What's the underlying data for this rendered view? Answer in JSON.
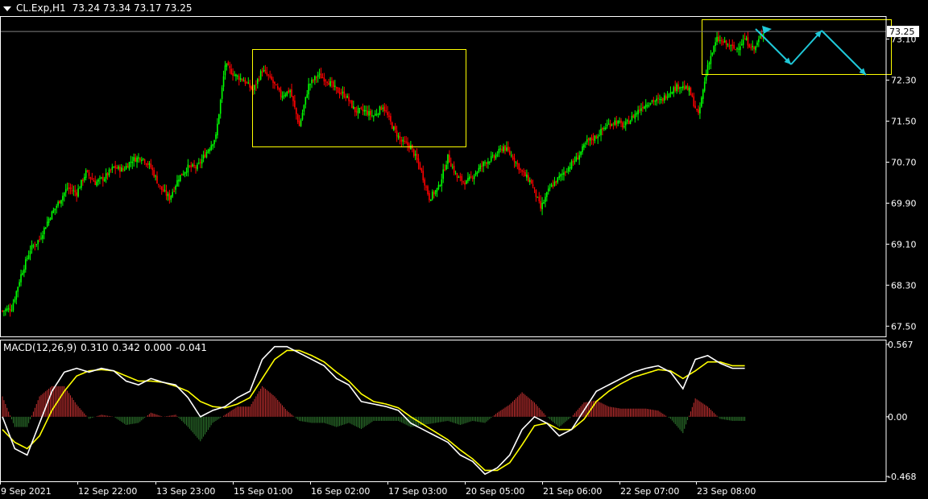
{
  "header": {
    "symbol_timeframe": "CL.Exp,H1",
    "ohlc": "73.24 73.34 73.17 73.25"
  },
  "macd": {
    "label": "MACD(12,26,9)",
    "values": [
      "0.310",
      "0.342",
      "0.000",
      "-0.041"
    ]
  },
  "colors": {
    "background": "#000000",
    "bull": "#00ff00",
    "bear": "#ff0000",
    "grid_border": "#ffffff",
    "box": "#ffff00",
    "arrow": "#1fc8d8",
    "price_line": "#808080",
    "hist_pos": "#c83232",
    "hist_neg": "#2f7a2f",
    "macd_line": "#ffffff",
    "signal_line": "#ffff00"
  },
  "chart_data": [
    {
      "type": "candlestick",
      "ylim": [
        67.3,
        73.55
      ],
      "y_ticks": [
        "73.10",
        "72.30",
        "71.50",
        "70.70",
        "69.90",
        "69.10",
        "68.30",
        "67.50"
      ],
      "current_price": "73.25",
      "x_ticks": [
        "9 Sep 2021",
        "12 Sep 22:00",
        "13 Sep 23:00",
        "15 Sep 01:00",
        "16 Sep 02:00",
        "17 Sep 03:00",
        "20 Sep 05:00",
        "21 Sep 06:00",
        "22 Sep 07:00",
        "23 Sep 08:00"
      ],
      "close_path": [
        [
          0,
          67.8
        ],
        [
          6,
          67.85
        ],
        [
          12,
          68.5
        ],
        [
          18,
          69.0
        ],
        [
          24,
          69.2
        ],
        [
          30,
          69.6
        ],
        [
          36,
          69.9
        ],
        [
          42,
          70.2
        ],
        [
          48,
          70.1
        ],
        [
          54,
          70.5
        ],
        [
          60,
          70.3
        ],
        [
          66,
          70.4
        ],
        [
          72,
          70.6
        ],
        [
          78,
          70.55
        ],
        [
          84,
          70.75
        ],
        [
          90,
          70.8
        ],
        [
          96,
          70.6
        ],
        [
          102,
          70.2
        ],
        [
          108,
          70.0
        ],
        [
          114,
          70.4
        ],
        [
          120,
          70.6
        ],
        [
          126,
          70.6
        ],
        [
          132,
          70.9
        ],
        [
          138,
          71.2
        ],
        [
          144,
          72.6
        ],
        [
          150,
          72.4
        ],
        [
          156,
          72.3
        ],
        [
          162,
          72.1
        ],
        [
          168,
          72.5
        ],
        [
          174,
          72.3
        ],
        [
          180,
          72.0
        ],
        [
          186,
          72.1
        ],
        [
          192,
          71.4
        ],
        [
          198,
          72.2
        ],
        [
          204,
          72.4
        ],
        [
          210,
          72.3
        ],
        [
          216,
          72.1
        ],
        [
          222,
          72.0
        ],
        [
          228,
          71.7
        ],
        [
          234,
          71.7
        ],
        [
          240,
          71.6
        ],
        [
          246,
          71.8
        ],
        [
          252,
          71.4
        ],
        [
          258,
          71.1
        ],
        [
          264,
          71.0
        ],
        [
          270,
          70.6
        ],
        [
          276,
          70.0
        ],
        [
          282,
          70.2
        ],
        [
          288,
          70.8
        ],
        [
          294,
          70.4
        ],
        [
          300,
          70.3
        ],
        [
          306,
          70.5
        ],
        [
          312,
          70.7
        ],
        [
          318,
          70.8
        ],
        [
          324,
          71.0
        ],
        [
          330,
          70.8
        ],
        [
          336,
          70.5
        ],
        [
          342,
          70.3
        ],
        [
          348,
          69.8
        ],
        [
          354,
          70.2
        ],
        [
          360,
          70.4
        ],
        [
          366,
          70.6
        ],
        [
          372,
          70.8
        ],
        [
          378,
          71.1
        ],
        [
          384,
          71.2
        ],
        [
          390,
          71.4
        ],
        [
          396,
          71.5
        ],
        [
          402,
          71.4
        ],
        [
          408,
          71.6
        ],
        [
          414,
          71.8
        ],
        [
          420,
          71.9
        ],
        [
          426,
          71.9
        ],
        [
          432,
          72.1
        ],
        [
          438,
          72.2
        ],
        [
          444,
          72.1
        ],
        [
          450,
          71.6
        ],
        [
          456,
          72.6
        ],
        [
          462,
          73.1
        ],
        [
          468,
          73.0
        ],
        [
          474,
          72.9
        ],
        [
          480,
          73.1
        ],
        [
          486,
          72.9
        ],
        [
          492,
          73.25
        ]
      ]
    },
    {
      "type": "macd",
      "ylim": [
        -0.468,
        0.567
      ],
      "y_ticks": [
        "0.567",
        "0.00",
        "-0.468"
      ],
      "macd_line": [
        [
          0,
          0.0
        ],
        [
          8,
          -0.25
        ],
        [
          16,
          -0.3
        ],
        [
          24,
          -0.05
        ],
        [
          32,
          0.2
        ],
        [
          40,
          0.35
        ],
        [
          48,
          0.38
        ],
        [
          56,
          0.35
        ],
        [
          64,
          0.38
        ],
        [
          72,
          0.36
        ],
        [
          80,
          0.28
        ],
        [
          88,
          0.25
        ],
        [
          96,
          0.3
        ],
        [
          104,
          0.27
        ],
        [
          112,
          0.25
        ],
        [
          120,
          0.15
        ],
        [
          128,
          0.0
        ],
        [
          136,
          0.05
        ],
        [
          144,
          0.08
        ],
        [
          152,
          0.15
        ],
        [
          160,
          0.2
        ],
        [
          168,
          0.45
        ],
        [
          176,
          0.55
        ],
        [
          184,
          0.55
        ],
        [
          192,
          0.5
        ],
        [
          200,
          0.45
        ],
        [
          208,
          0.4
        ],
        [
          216,
          0.3
        ],
        [
          224,
          0.25
        ],
        [
          232,
          0.12
        ],
        [
          240,
          0.1
        ],
        [
          248,
          0.08
        ],
        [
          256,
          0.05
        ],
        [
          264,
          -0.05
        ],
        [
          272,
          -0.1
        ],
        [
          280,
          -0.15
        ],
        [
          288,
          -0.2
        ],
        [
          296,
          -0.3
        ],
        [
          304,
          -0.35
        ],
        [
          312,
          -0.45
        ],
        [
          320,
          -0.4
        ],
        [
          328,
          -0.3
        ],
        [
          336,
          -0.1
        ],
        [
          344,
          0.0
        ],
        [
          352,
          -0.05
        ],
        [
          360,
          -0.15
        ],
        [
          368,
          -0.1
        ],
        [
          376,
          0.05
        ],
        [
          384,
          0.2
        ],
        [
          392,
          0.25
        ],
        [
          400,
          0.3
        ],
        [
          408,
          0.35
        ],
        [
          416,
          0.38
        ],
        [
          424,
          0.4
        ],
        [
          432,
          0.35
        ],
        [
          440,
          0.22
        ],
        [
          448,
          0.45
        ],
        [
          456,
          0.48
        ],
        [
          464,
          0.42
        ],
        [
          472,
          0.38
        ],
        [
          480,
          0.38
        ]
      ],
      "signal_line": [
        [
          0,
          -0.1
        ],
        [
          8,
          -0.2
        ],
        [
          16,
          -0.25
        ],
        [
          24,
          -0.15
        ],
        [
          32,
          0.05
        ],
        [
          40,
          0.2
        ],
        [
          48,
          0.32
        ],
        [
          56,
          0.36
        ],
        [
          64,
          0.37
        ],
        [
          72,
          0.36
        ],
        [
          80,
          0.32
        ],
        [
          88,
          0.28
        ],
        [
          96,
          0.28
        ],
        [
          104,
          0.27
        ],
        [
          112,
          0.24
        ],
        [
          120,
          0.2
        ],
        [
          128,
          0.12
        ],
        [
          136,
          0.08
        ],
        [
          144,
          0.07
        ],
        [
          152,
          0.1
        ],
        [
          160,
          0.15
        ],
        [
          168,
          0.3
        ],
        [
          176,
          0.45
        ],
        [
          184,
          0.52
        ],
        [
          192,
          0.52
        ],
        [
          200,
          0.48
        ],
        [
          208,
          0.43
        ],
        [
          216,
          0.35
        ],
        [
          224,
          0.28
        ],
        [
          232,
          0.18
        ],
        [
          240,
          0.12
        ],
        [
          248,
          0.1
        ],
        [
          256,
          0.07
        ],
        [
          264,
          0.0
        ],
        [
          272,
          -0.06
        ],
        [
          280,
          -0.12
        ],
        [
          288,
          -0.18
        ],
        [
          296,
          -0.26
        ],
        [
          304,
          -0.33
        ],
        [
          312,
          -0.42
        ],
        [
          320,
          -0.42
        ],
        [
          328,
          -0.36
        ],
        [
          336,
          -0.22
        ],
        [
          344,
          -0.07
        ],
        [
          352,
          -0.05
        ],
        [
          360,
          -0.1
        ],
        [
          368,
          -0.1
        ],
        [
          376,
          -0.02
        ],
        [
          384,
          0.12
        ],
        [
          392,
          0.2
        ],
        [
          400,
          0.26
        ],
        [
          408,
          0.31
        ],
        [
          416,
          0.34
        ],
        [
          424,
          0.37
        ],
        [
          432,
          0.36
        ],
        [
          440,
          0.3
        ],
        [
          448,
          0.36
        ],
        [
          456,
          0.43
        ],
        [
          464,
          0.43
        ],
        [
          472,
          0.4
        ],
        [
          480,
          0.4
        ]
      ]
    }
  ]
}
